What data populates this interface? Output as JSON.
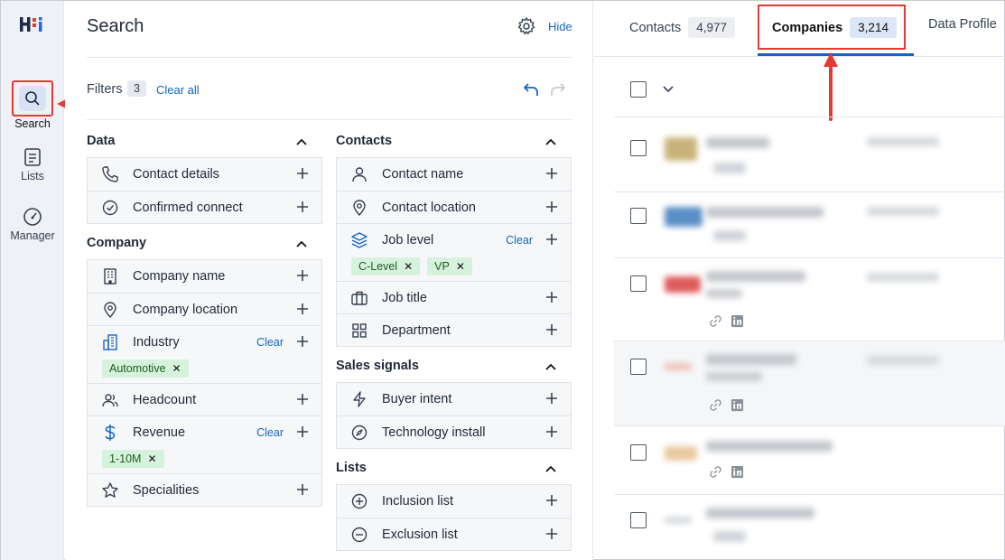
{
  "nav": {
    "search_label": "Search",
    "lists_label": "Lists",
    "manager_label": "Manager"
  },
  "panel": {
    "title": "Search",
    "hide_label": "Hide",
    "filters_label": "Filters",
    "filters_count": "3",
    "clear_all": "Clear all"
  },
  "col1": {
    "data": {
      "title": "Data",
      "items": [
        "Contact details",
        "Confirmed connect"
      ]
    },
    "company": {
      "title": "Company",
      "items": [
        "Company name",
        "Company location",
        "Industry",
        "Headcount",
        "Revenue",
        "Specialities"
      ],
      "industry_clear": "Clear",
      "industry_chip": "Automotive",
      "revenue_clear": "Clear",
      "revenue_chip": "1-10M"
    }
  },
  "col2": {
    "contacts": {
      "title": "Contacts",
      "items": [
        "Contact name",
        "Contact location",
        "Job level",
        "Job title",
        "Department"
      ],
      "job_level_clear": "Clear",
      "job_level_chips": [
        "C-Level",
        "VP"
      ]
    },
    "sales": {
      "title": "Sales signals",
      "items": [
        "Buyer intent",
        "Technology install"
      ]
    },
    "lists": {
      "title": "Lists",
      "items": [
        "Inclusion list",
        "Exclusion list"
      ]
    }
  },
  "tabs": {
    "contacts_label": "Contacts",
    "contacts_count": "4,977",
    "companies_label": "Companies",
    "companies_count": "3,214",
    "data_profile_label": "Data Profile"
  },
  "colors": {
    "accent": "#1565c0",
    "highlight": "#e53935",
    "chip_bg": "#d6f2dc"
  }
}
